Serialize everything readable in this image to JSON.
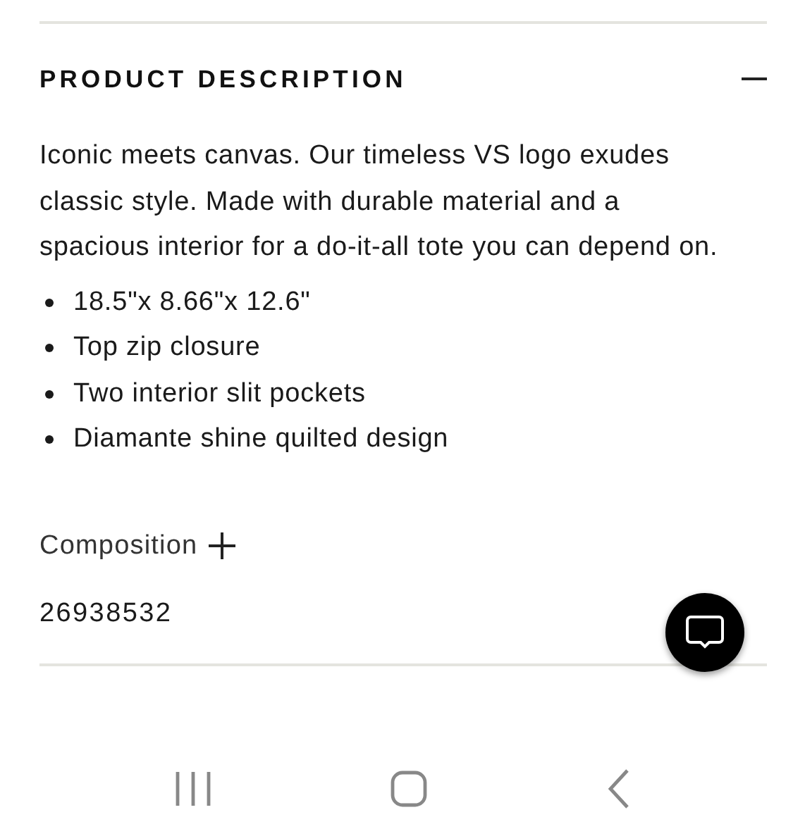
{
  "description": {
    "title": "PRODUCT DESCRIPTION",
    "expanded": true,
    "paragraph": "Iconic meets canvas. Our timeless VS logo exudes classic style. Made with durable material and a spacious interior for a do-it-all tote you can depend on.",
    "bullets": [
      "18.5\"x 8.66\"x 12.6\"",
      "Top zip closure",
      "Two interior slit pockets",
      "Diamante shine quilted design"
    ]
  },
  "composition": {
    "title": "Composition",
    "expanded": false
  },
  "product_number": "26938532"
}
